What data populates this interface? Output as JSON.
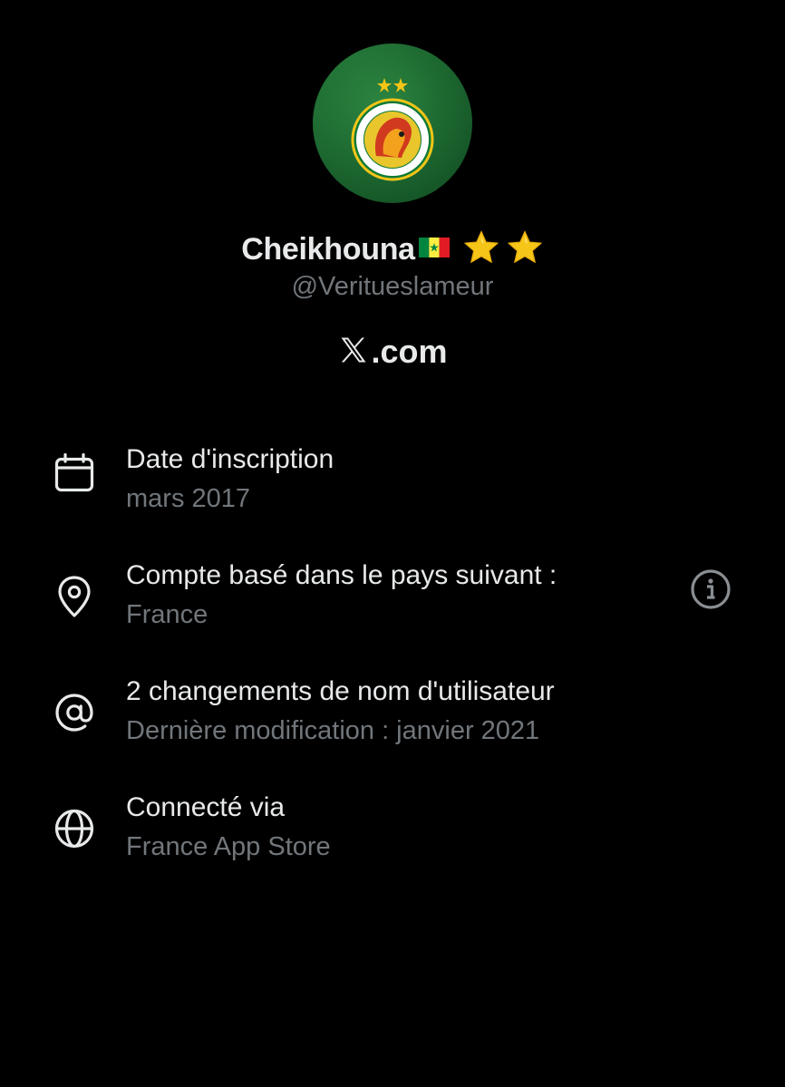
{
  "profile": {
    "display_name": "Cheikhouna",
    "name_emojis": {
      "flag": "senegal-flag-icon",
      "stars": [
        "star-icon",
        "star-icon"
      ]
    },
    "handle": "@Veritueslameur",
    "avatar": "senegal-football-federation-logo"
  },
  "brand": {
    "mark": "𝕏",
    "suffix": ".com"
  },
  "details": [
    {
      "icon": "calendar-icon",
      "title": "Date d'inscription",
      "value": "mars 2017"
    },
    {
      "icon": "location-pin-icon",
      "title": "Compte basé dans le pays suivant :",
      "value": "France",
      "action_icon": "info-icon"
    },
    {
      "icon": "at-sign-icon",
      "title": "2 changements de nom d'utilisateur",
      "value": "Dernière modification : janvier 2021"
    },
    {
      "icon": "globe-icon",
      "title": "Connecté via",
      "value": "France App Store"
    }
  ],
  "colors": {
    "background": "#000000",
    "primary_text": "#e7e9ea",
    "secondary_text": "#71767b",
    "icon": "#e7e9ea",
    "info_icon": "#8b8f93",
    "star": "#f5c518",
    "avatar_green": "#1d6a31"
  }
}
